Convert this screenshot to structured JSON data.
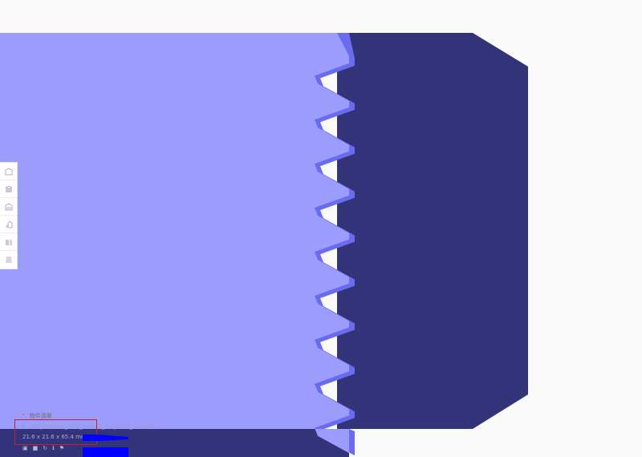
{
  "object_list": {
    "title": "物件清單",
    "filename": "Body-Screen_M18_core48_PingiCPU_Nozzle0.4",
    "dimensions": "21.6 x 21.6 x 65.4 mm"
  },
  "colors": {
    "background": "#fafafa",
    "part_light": "#9b9cfb",
    "part_dark": "#33337a",
    "part_edge": "#6a6cf0",
    "highlight_box": "#c0202a",
    "progress": "#0000ff"
  },
  "toolbar": {
    "icons": [
      "view-3d-icon",
      "view-front-icon",
      "view-top-icon",
      "view-left-icon",
      "view-right-icon",
      "view-bottom-icon"
    ]
  }
}
